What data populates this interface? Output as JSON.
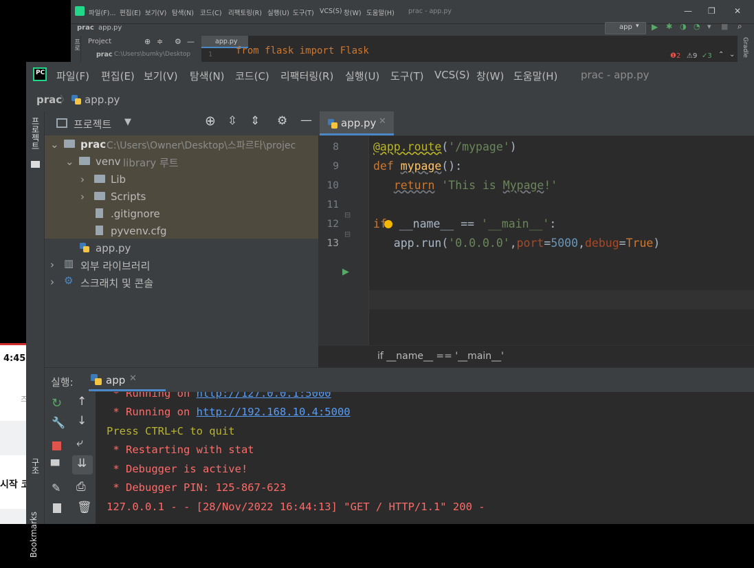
{
  "background": {
    "time": "4:45",
    "fragment_text": "시작 코",
    "fragment_small": "즈",
    "back_window": {
      "menu": [
        "파일(F)...",
        "편집(E)",
        "보기(V)",
        "탐색(N)",
        "코드(C)",
        "리팩토링(R)",
        "실행(U)",
        "도구(T)",
        "VCS(S)",
        "창(W)",
        "도움말(H)"
      ],
      "title": "prac - app.py",
      "breadcrumb_project": "prac",
      "breadcrumb_file": "app.py",
      "project_label": "Project",
      "tab_label": "app.py",
      "run_config": "app",
      "tree_root": "prac",
      "tree_root_path": "C:\\Users\\bumky\\Desktop",
      "code_line": "from flask import Flask",
      "line_no": "1",
      "inspections": {
        "errors": "2",
        "warnings": "9",
        "weak": "3"
      },
      "side_label": "Gradle"
    }
  },
  "window": {
    "title": "prac - app.py",
    "menu": [
      "파일(F)",
      "편집(E)",
      "보기(V)",
      "탐색(N)",
      "코드(C)",
      "리팩터링(R)",
      "실행(U)",
      "도구(T)",
      "VCS(S)",
      "창(W)",
      "도움말(H)"
    ],
    "breadcrumb": {
      "project": "prac",
      "file": "app.py"
    },
    "left_strip_label": "프로젝트",
    "bottom_strip_labels": [
      "구조",
      "Bookmarks"
    ]
  },
  "project": {
    "header_label": "프로젝트",
    "tree": [
      {
        "label": "prac",
        "detail": "C:\\Users\\Owner\\Desktop\\스파르타\\projec",
        "kind": "folder"
      },
      {
        "label": "venv",
        "detail": "library 루트",
        "kind": "folder"
      },
      {
        "label": "Lib",
        "detail": "",
        "kind": "folder"
      },
      {
        "label": "Scripts",
        "detail": "",
        "kind": "folder"
      },
      {
        "label": ".gitignore",
        "detail": "",
        "kind": "file"
      },
      {
        "label": "pyvenv.cfg",
        "detail": "",
        "kind": "file"
      },
      {
        "label": "app.py",
        "detail": "",
        "kind": "python"
      },
      {
        "label": "외부 라이브러리",
        "detail": "",
        "kind": "library"
      },
      {
        "label": "스크래치 및 콘솔",
        "detail": "",
        "kind": "scratch"
      }
    ]
  },
  "editor": {
    "tab_label": "app.py",
    "lines": [
      {
        "no": "8"
      },
      {
        "no": "9"
      },
      {
        "no": "10"
      },
      {
        "no": "11"
      },
      {
        "no": "12"
      },
      {
        "no": "13"
      }
    ],
    "breadcrumb": "if __name__ == '__main__'"
  },
  "run": {
    "label": "실행:",
    "tab_label": "app",
    "console": [
      {
        "text_pre": " * Running on ",
        "link": "http://127.0.0.1:5000",
        "style": "red"
      },
      {
        "text_pre": " * Running on ",
        "link": "http://192.168.10.4:5000",
        "style": "red"
      },
      {
        "text": "Press CTRL+C to quit",
        "style": "yel"
      },
      {
        "text": " * Restarting with stat",
        "style": "red"
      },
      {
        "text": " * Debugger is active!",
        "style": "red"
      },
      {
        "text": " * Debugger PIN: 125-867-623",
        "style": "red"
      },
      {
        "text": "127.0.0.1 - - [28/Nov/2022 16:44:13] \"GET / HTTP/1.1\" 200 -",
        "style": "red"
      }
    ]
  },
  "colors": {
    "accent": "#4a88c7",
    "bg": "#2b2b2b",
    "panel": "#3c3f41"
  }
}
